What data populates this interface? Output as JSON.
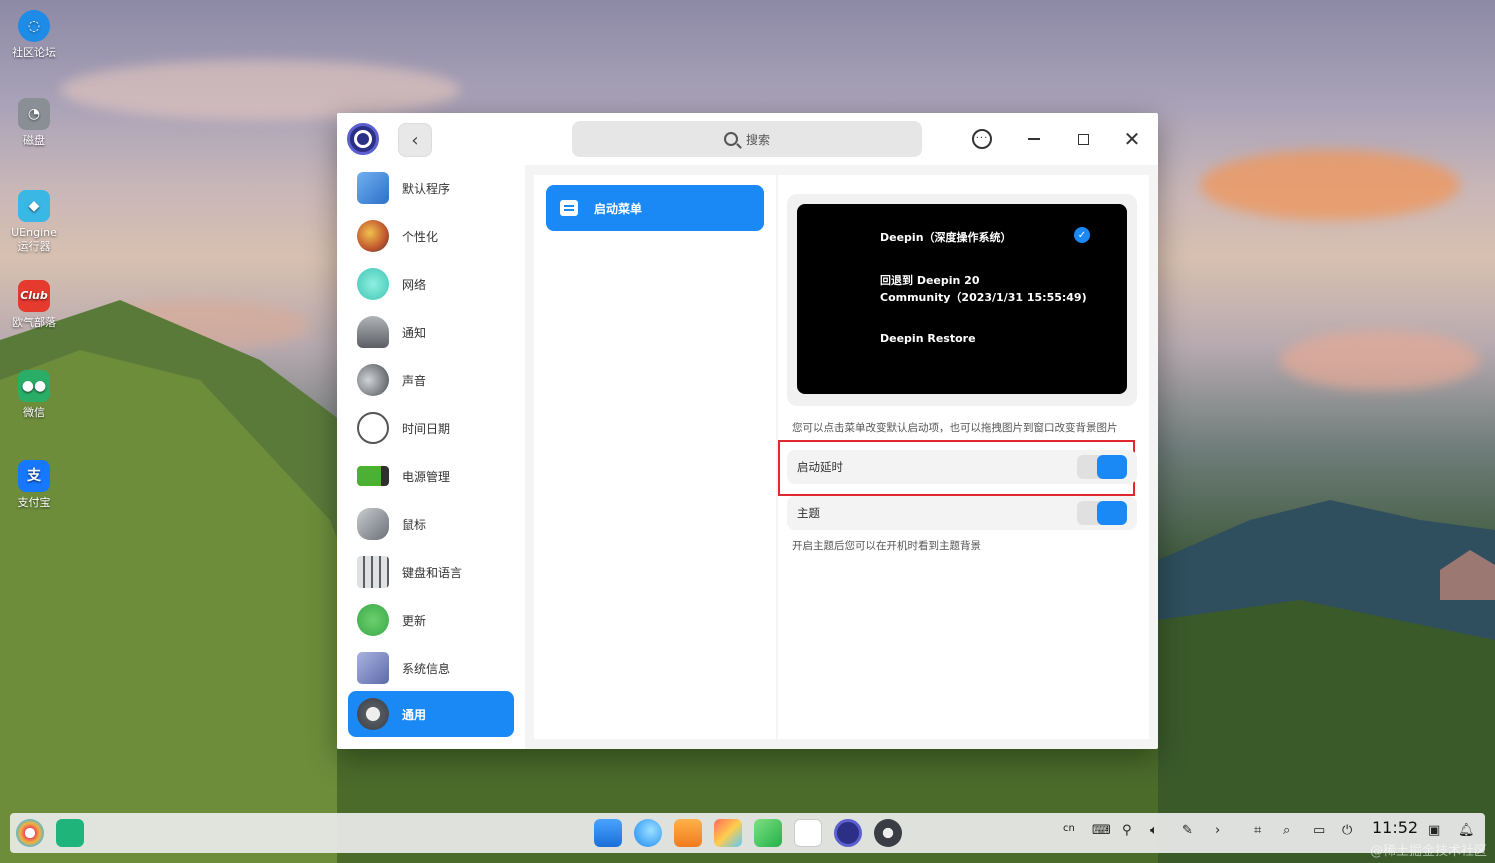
{
  "desktop": {
    "icons": [
      {
        "label": "社区论坛",
        "icon": "deepin-forum-icon",
        "color": "#1e8be6"
      },
      {
        "label": "磁盘",
        "icon": "disk-icon",
        "color": "#8a8f95"
      },
      {
        "label": "UEngine 运行器",
        "icon": "uengine-icon",
        "color": "#39b8e6"
      },
      {
        "label": "欧气部落",
        "icon": "club-icon",
        "color": "#e63a2e"
      },
      {
        "label": "微信",
        "icon": "wechat-icon",
        "color": "#2aae67"
      },
      {
        "label": "支付宝",
        "icon": "alipay-icon",
        "color": "#1677ff"
      }
    ]
  },
  "window": {
    "search_placeholder": "搜索",
    "sidebar": {
      "items": [
        {
          "label": "默认程序",
          "icon": "default-apps-icon",
          "color": "#4a90d9"
        },
        {
          "label": "个性化",
          "icon": "personalization-icon",
          "color": "#c0552d"
        },
        {
          "label": "网络",
          "icon": "network-icon",
          "color": "#3fc4b4"
        },
        {
          "label": "通知",
          "icon": "notification-bell-icon",
          "color": "#7a7f85"
        },
        {
          "label": "声音",
          "icon": "sound-icon",
          "color": "#5a5e64"
        },
        {
          "label": "时间日期",
          "icon": "clock-icon",
          "color": "#ffffff"
        },
        {
          "label": "电源管理",
          "icon": "battery-icon",
          "color": "#4cb034"
        },
        {
          "label": "鼠标",
          "icon": "mouse-icon",
          "color": "#8a8f95"
        },
        {
          "label": "键盘和语言",
          "icon": "keyboard-icon",
          "color": "#6b7077"
        },
        {
          "label": "更新",
          "icon": "update-icon",
          "color": "#3aa84a"
        },
        {
          "label": "系统信息",
          "icon": "system-info-icon",
          "color": "#5c6aa8"
        },
        {
          "label": "通用",
          "icon": "general-gear-icon",
          "color": "#555a60",
          "active": true
        }
      ]
    },
    "middle": {
      "items": [
        {
          "label": "启动菜单",
          "active": true
        }
      ]
    },
    "content": {
      "boot_entries": [
        {
          "text": "Deepin（深度操作系统）",
          "selected": true
        },
        {
          "line1": "回退到 Deepin 20",
          "line2": "Community（2023/1/31 15:55:49)"
        },
        {
          "text": "Deepin Restore"
        }
      ],
      "hint": "您可以点击菜单改变默认启动项，也可以拖拽图片到窗口改变背景图片",
      "settings": [
        {
          "label": "启动延时",
          "enabled": true,
          "highlighted": true
        },
        {
          "label": "主题",
          "enabled": true
        }
      ],
      "theme_hint": "开启主题后您可以在开机时看到主题背景"
    },
    "accent_color": "#1a88f5"
  },
  "taskbar": {
    "tray": {
      "input_method": "cn",
      "time": "11:52"
    },
    "watermark": "@稀土掘金技术社区"
  }
}
